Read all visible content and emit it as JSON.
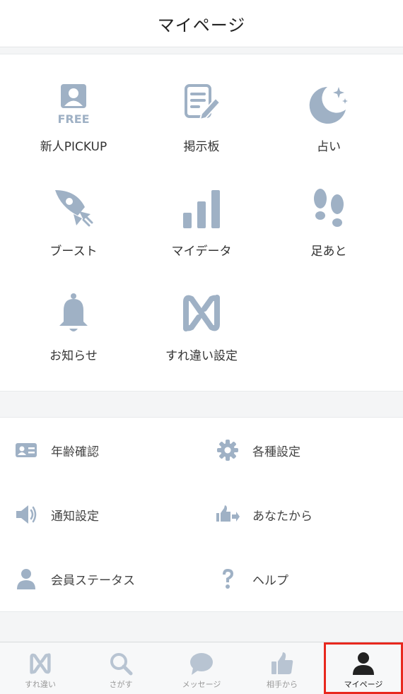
{
  "header": {
    "title": "マイページ"
  },
  "colors": {
    "icon": "#9fb1c5",
    "active": "#222222",
    "highlight": "#e8281e"
  },
  "menu_grid": [
    {
      "label": "新人PICKUP",
      "icon": "free-user-icon",
      "badge": "FREE"
    },
    {
      "label": "掲示板",
      "icon": "notepad-pencil-icon"
    },
    {
      "label": "占い",
      "icon": "moon-stars-icon"
    },
    {
      "label": "ブースト",
      "icon": "rocket-icon"
    },
    {
      "label": "マイデータ",
      "icon": "bar-chart-icon"
    },
    {
      "label": "足あと",
      "icon": "footprints-icon"
    },
    {
      "label": "お知らせ",
      "icon": "bell-icon"
    },
    {
      "label": "すれ違い設定",
      "icon": "surechigai-logo-icon"
    }
  ],
  "settings_list": [
    {
      "label": "年齢確認",
      "icon": "id-card-icon"
    },
    {
      "label": "各種設定",
      "icon": "gear-icon"
    },
    {
      "label": "通知設定",
      "icon": "speaker-icon"
    },
    {
      "label": "あなたから",
      "icon": "thumbs-up-arrow-icon"
    },
    {
      "label": "会員ステータス",
      "icon": "person-icon"
    },
    {
      "label": "ヘルプ",
      "icon": "question-icon"
    }
  ],
  "tabbar": [
    {
      "label": "すれ違い",
      "icon": "surechigai-logo-icon",
      "active": false
    },
    {
      "label": "さがす",
      "icon": "search-icon",
      "active": false
    },
    {
      "label": "メッセージ",
      "icon": "chat-bubble-icon",
      "active": false
    },
    {
      "label": "相手から",
      "icon": "thumbs-up-icon",
      "active": false
    },
    {
      "label": "マイページ",
      "icon": "person-icon",
      "active": true
    }
  ]
}
